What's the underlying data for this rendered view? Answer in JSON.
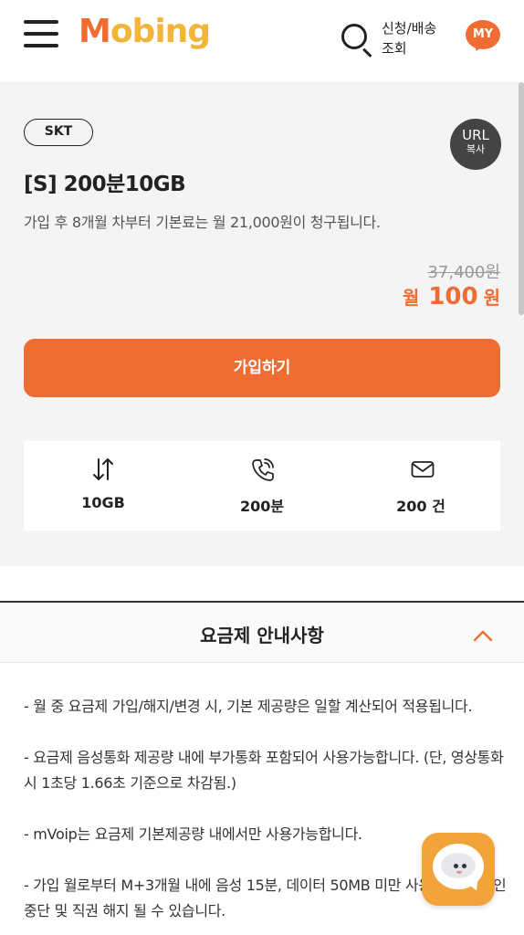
{
  "header": {
    "logo_text_first": "M",
    "logo_text_rest": "obing",
    "search_label": "신청/배송 조회",
    "my_label": "MY",
    "brand_color": "#ef6c33",
    "logo_secondary_color": "#f2b53a"
  },
  "plan": {
    "carrier": "SKT",
    "url_copy_line1": "URL",
    "url_copy_line2": "복사",
    "name": "[S] 200분10GB",
    "description": "가입 후 8개월 차부터 기본료는 월 21,000원이 청구됩니다.",
    "original_price": "37,400원",
    "sale_prefix": "월",
    "sale_amount": "100",
    "sale_unit": "원",
    "join_button": "가입하기",
    "features": [
      {
        "icon": "data-transfer-icon",
        "value": "10GB"
      },
      {
        "icon": "phone-call-icon",
        "value": "200분"
      },
      {
        "icon": "mail-icon",
        "value": "200 건"
      }
    ]
  },
  "notice": {
    "title": "요금제 안내사항",
    "items": [
      "- 월 중 요금제 가입/해지/변경 시, 기본 제공량은 일할 계산되어 적용됩니다.",
      "- 요금제 음성통화 제공량 내에 부가통화 포함되어 사용가능합니다. (단, 영상통화 시 1초당 1.66초 기준으로 차감됨.)",
      "- mVoip는 요금제 기본제공량 내에서만 사용가능합니다.",
      "- 가입 월로부터 M+3개월 내에 음성 15분, 데이터 50MB 미만 사용 회선은 할인 중단 및 직권 해지 될 수 있습니다."
    ]
  },
  "chat": {
    "icon": "chatbot-icon"
  }
}
